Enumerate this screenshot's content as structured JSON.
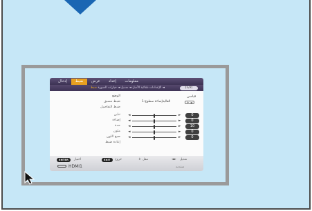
{
  "menu": {
    "tabs": [
      {
        "label": "معلومات",
        "active": false
      },
      {
        "label": "إعداد",
        "active": false
      },
      {
        "label": "عرض",
        "active": false
      },
      {
        "label": "ضبط",
        "active": true
      },
      {
        "label": "إدخال",
        "active": false
      }
    ],
    "breadcrumb_prefix": "◄ الإعدادات تلقائية الأصل ◄ تعديل ◄ خيارات الصورة",
    "breadcrumb_active": "ضبط",
    "page_indicator": "(1/2)",
    "items": [
      "الوضع",
      "ضبط مسبق",
      "ضبط التفاصيل",
      "تباين",
      "إضاءة",
      "حدة",
      "ملون",
      "صبغ اللون",
      "إعادة ضبط"
    ],
    "right_title": "قياسي",
    "right_row_text": "1:العاليةإضاءة سطوع",
    "stepper_label": "+  ◄",
    "sliders": [
      {
        "label": "تباين",
        "value": "0",
        "level": 0.5
      },
      {
        "label": "إضاءة",
        "value": "0",
        "level": 0.5
      },
      {
        "label": "حدة",
        "value": "10",
        "level": 0.5
      },
      {
        "label": "ملون",
        "value": "0",
        "level": 0.5
      },
      {
        "label": "صبغ اللون",
        "value": "0",
        "level": 0.5
      }
    ],
    "footer": {
      "enter_key": "ENTER",
      "enter_text": "اختيار",
      "exit_key": "EXIT",
      "exit_text": "خروج",
      "move_text": "تنقل",
      "adjust_text": "تعديل",
      "input_label": "HDMI1",
      "state_label": "متقدمة"
    }
  },
  "colors": {
    "screen_bg": "#c6e7f7",
    "pointer": "#1a66b3",
    "frame": "#9a9a9a",
    "active_tab": "#e8a020"
  }
}
